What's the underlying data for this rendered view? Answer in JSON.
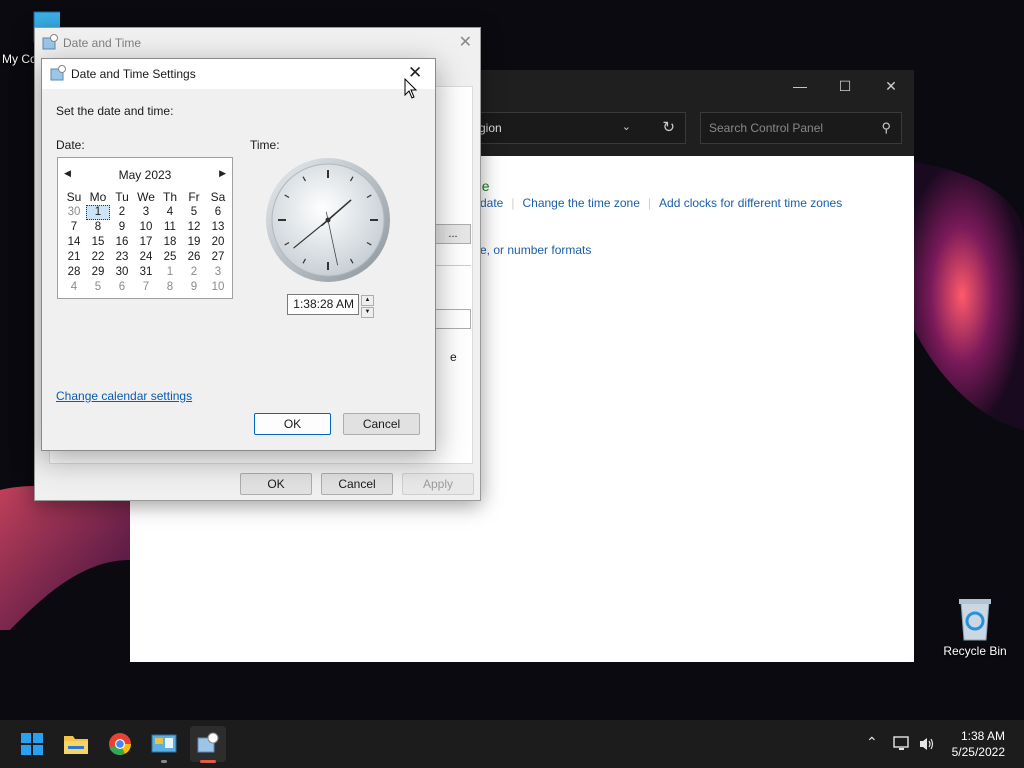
{
  "desktop": {
    "my_computer_label": "My Co",
    "recycle_bin_label": "Recycle Bin"
  },
  "control_panel": {
    "address_text": "gion",
    "search_placeholder": "Search Control Panel",
    "heading_fragment": "ne",
    "links": [
      "date",
      "Change the time zone",
      "Add clocks for different time zones"
    ],
    "link2": "e, or number formats"
  },
  "date_time_dialog": {
    "title": "Date and Time",
    "fragment_button": "...",
    "fragment_text": "e",
    "ok_label": "OK",
    "cancel_label": "Cancel",
    "apply_label": "Apply"
  },
  "settings_dialog": {
    "title": "Date and Time Settings",
    "intro": "Set the date and time:",
    "date_label": "Date:",
    "time_label": "Time:",
    "month_label": "May 2023",
    "weekdays": [
      "Su",
      "Mo",
      "Tu",
      "We",
      "Th",
      "Fr",
      "Sa"
    ],
    "weeks": [
      [
        {
          "d": "30",
          "o": true
        },
        {
          "d": "1",
          "sel": true
        },
        {
          "d": "2"
        },
        {
          "d": "3"
        },
        {
          "d": "4"
        },
        {
          "d": "5"
        },
        {
          "d": "6"
        }
      ],
      [
        {
          "d": "7"
        },
        {
          "d": "8"
        },
        {
          "d": "9"
        },
        {
          "d": "10"
        },
        {
          "d": "11"
        },
        {
          "d": "12"
        },
        {
          "d": "13"
        }
      ],
      [
        {
          "d": "14"
        },
        {
          "d": "15"
        },
        {
          "d": "16"
        },
        {
          "d": "17"
        },
        {
          "d": "18"
        },
        {
          "d": "19"
        },
        {
          "d": "20"
        }
      ],
      [
        {
          "d": "21"
        },
        {
          "d": "22"
        },
        {
          "d": "23"
        },
        {
          "d": "24"
        },
        {
          "d": "25"
        },
        {
          "d": "26"
        },
        {
          "d": "27"
        }
      ],
      [
        {
          "d": "28"
        },
        {
          "d": "29"
        },
        {
          "d": "30"
        },
        {
          "d": "31"
        },
        {
          "d": "1",
          "o": true
        },
        {
          "d": "2",
          "o": true
        },
        {
          "d": "3",
          "o": true
        }
      ],
      [
        {
          "d": "4",
          "o": true
        },
        {
          "d": "5",
          "o": true
        },
        {
          "d": "6",
          "o": true
        },
        {
          "d": "7",
          "o": true
        },
        {
          "d": "8",
          "o": true
        },
        {
          "d": "9",
          "o": true
        },
        {
          "d": "10",
          "o": true
        }
      ]
    ],
    "time_value": "1:38:28 AM",
    "clock": {
      "hour": 1,
      "minute": 38,
      "second": 28
    },
    "change_calendar_link": "Change calendar settings",
    "ok_label": "OK",
    "cancel_label": "Cancel"
  },
  "taskbar": {
    "tray_time": "1:38 AM",
    "tray_date": "5/25/2022",
    "apps": [
      "start-icon",
      "file-explorer-icon",
      "chrome-icon",
      "control-panel-icon",
      "date-time-settings-icon"
    ]
  },
  "colors": {
    "accent": "#0067c0",
    "link": "#1a5fa8",
    "cp_heading": "#1e7a1e",
    "taskbar": "#1c1c1c",
    "active_indicator": "#e45a4a"
  }
}
